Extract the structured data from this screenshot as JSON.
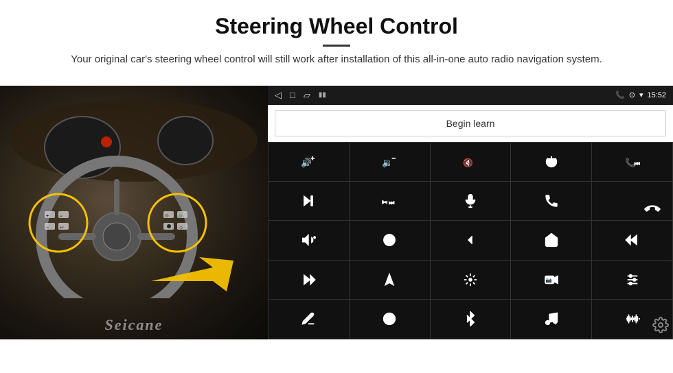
{
  "header": {
    "title": "Steering Wheel Control",
    "subtitle": "Your original car's steering wheel control will still work after installation of this all-in-one auto radio navigation system."
  },
  "status_bar": {
    "time": "15:52",
    "nav_icons": [
      "◁",
      "□",
      "▷"
    ]
  },
  "begin_learn": {
    "label": "Begin learn"
  },
  "controls": [
    {
      "icon": "vol_up",
      "label": "Volume Up",
      "unicode": "🔊+"
    },
    {
      "icon": "vol_down",
      "label": "Volume Down",
      "unicode": "🔉-"
    },
    {
      "icon": "vol_mute",
      "label": "Volume Mute",
      "unicode": "🔇"
    },
    {
      "icon": "power",
      "label": "Power"
    },
    {
      "icon": "prev_track",
      "label": "Previous/Rewind"
    },
    {
      "icon": "next",
      "label": "Next Track"
    },
    {
      "icon": "fast_forward",
      "label": "Fast Forward"
    },
    {
      "icon": "mic",
      "label": "Microphone"
    },
    {
      "icon": "phone",
      "label": "Phone"
    },
    {
      "icon": "hang_up",
      "label": "Hang Up"
    },
    {
      "icon": "horn",
      "label": "Horn"
    },
    {
      "icon": "360_view",
      "label": "360 View"
    },
    {
      "icon": "back",
      "label": "Back"
    },
    {
      "icon": "home",
      "label": "Home"
    },
    {
      "icon": "skip_prev",
      "label": "Skip Previous"
    },
    {
      "icon": "skip_next",
      "label": "Skip Next"
    },
    {
      "icon": "navigate",
      "label": "Navigate"
    },
    {
      "icon": "equalizer",
      "label": "Equalizer"
    },
    {
      "icon": "camera",
      "label": "Camera"
    },
    {
      "icon": "settings_sliders",
      "label": "Settings Sliders"
    },
    {
      "icon": "pen",
      "label": "Pen/Draw"
    },
    {
      "icon": "circle_dot",
      "label": "Circle"
    },
    {
      "icon": "bluetooth",
      "label": "Bluetooth"
    },
    {
      "icon": "music",
      "label": "Music"
    },
    {
      "icon": "waveform",
      "label": "Waveform"
    }
  ],
  "brand": "Seicane",
  "colors": {
    "accent": "#f5c000",
    "panel_bg": "#000",
    "status_bg": "#1a1a1a"
  }
}
